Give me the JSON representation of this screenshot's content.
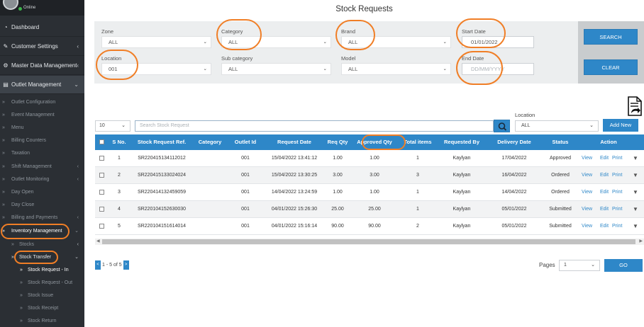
{
  "user": {
    "status": "Online"
  },
  "sidebar": {
    "main_items": [
      {
        "label": "Dashboard",
        "icon": "dashboard-icon",
        "glyph": "⚙"
      },
      {
        "label": "Customer Settings",
        "icon": "wrench-icon",
        "glyph": "🔧"
      },
      {
        "label": "Master Data Management",
        "icon": "gear-icon",
        "glyph": "⚙"
      },
      {
        "label": "Outlet Management",
        "icon": "store-icon",
        "glyph": "▦"
      }
    ],
    "outlet_subitems": [
      "Outlet Configuration",
      "Event Management",
      "Menu",
      "Billing Counters",
      "Taxation",
      "Shift Management",
      "Outlet Monitoring",
      "Day Open",
      "Day Close",
      "Billing and Payments",
      "Inventory Management"
    ],
    "inventory_subitems": [
      "Stocks",
      "Stock Transfer"
    ],
    "stock_transfer_subitems": [
      "Stock Request - In",
      "Stock Request - Out",
      "Stock Issue",
      "Stock Receipt",
      "Stock Return"
    ]
  },
  "page": {
    "title": "Stock Requests"
  },
  "filters": {
    "zone": {
      "label": "Zone",
      "value": "ALL"
    },
    "category": {
      "label": "Category",
      "value": "ALL"
    },
    "brand": {
      "label": "Brand",
      "value": "ALL"
    },
    "start_date": {
      "label": "Start Date",
      "value": "01/01/2022"
    },
    "location": {
      "label": "Location",
      "value": "001"
    },
    "sub_category": {
      "label": "Sub category",
      "value": "ALL"
    },
    "model": {
      "label": "Model",
      "value": "ALL"
    },
    "end_date": {
      "label": "End Date",
      "placeholder": "DD/MM/YYYY"
    },
    "search_button": "SEARCH",
    "clear_button": "CLEAR"
  },
  "toolbar": {
    "page_length": "10",
    "search_placeholder": "Search Stock Request",
    "location_label": "Location",
    "location_value": "ALL",
    "add_new": "Add New"
  },
  "table": {
    "columns": [
      "S No.",
      "Stock Request Ref.",
      "Category",
      "Outlet Id",
      "Request Date",
      "Req Qty",
      "Approved Qty",
      "Total items",
      "Requested By",
      "Delivery Date",
      "Status",
      "Action"
    ],
    "rows": [
      {
        "sno": "1",
        "ref": "SR220415134112012",
        "category": "",
        "outlet": "001",
        "request_date": "15/04/2022 13:41:12",
        "req_qty": "1.00",
        "approved_qty": "1.00",
        "total_items": "1",
        "requested_by": "Kaylyan",
        "delivery_date": "17/04/2022",
        "status": "Approved"
      },
      {
        "sno": "2",
        "ref": "SR220415133024024",
        "category": "",
        "outlet": "001",
        "request_date": "15/04/2022 13:30:25",
        "req_qty": "3.00",
        "approved_qty": "3.00",
        "total_items": "3",
        "requested_by": "Kaylyan",
        "delivery_date": "16/04/2022",
        "status": "Ordered"
      },
      {
        "sno": "3",
        "ref": "SR220414132459059",
        "category": "",
        "outlet": "001",
        "request_date": "14/04/2022 13:24:59",
        "req_qty": "1.00",
        "approved_qty": "1.00",
        "total_items": "1",
        "requested_by": "Kaylyan",
        "delivery_date": "14/04/2022",
        "status": "Ordered"
      },
      {
        "sno": "4",
        "ref": "SR220104152630030",
        "category": "",
        "outlet": "001",
        "request_date": "04/01/2022 15:26:30",
        "req_qty": "25.00",
        "approved_qty": "25.00",
        "total_items": "1",
        "requested_by": "Kaylyan",
        "delivery_date": "05/01/2022",
        "status": "Submitted"
      },
      {
        "sno": "5",
        "ref": "SR220104151614014",
        "category": "",
        "outlet": "001",
        "request_date": "04/01/2022 15:16:14",
        "req_qty": "90.00",
        "approved_qty": "90.00",
        "total_items": "2",
        "requested_by": "Kaylyan",
        "delivery_date": "05/01/2022",
        "status": "Submitted"
      }
    ],
    "actions": {
      "view": "View",
      "edit": "Edit",
      "print": "Print"
    }
  },
  "pagination": {
    "info": "1 - 5 of 5",
    "pages_label": "Pages",
    "pages_value": "1",
    "go_button": "GO"
  },
  "colors": {
    "accent": "#2e87c8",
    "sidebar_bg": "#2b2f34",
    "annotation": "#f07e26"
  }
}
